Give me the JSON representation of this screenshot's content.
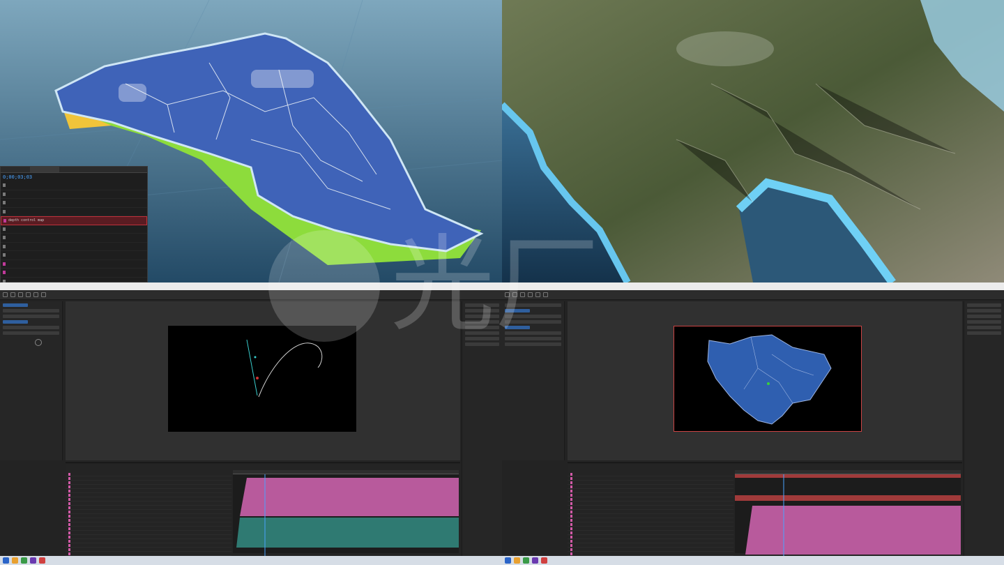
{
  "layer_panel": {
    "tabs": [
      "",
      "",
      "",
      "",
      ""
    ],
    "timecode": "0;00;03;03",
    "layers": [
      {
        "name": "",
        "color": "#7a7a7a"
      },
      {
        "name": "",
        "color": "#7a7a7a"
      },
      {
        "name": "",
        "color": "#7a7a7a"
      },
      {
        "name": "",
        "color": "#7a7a7a"
      },
      {
        "name": "depth control map",
        "color": "#c03a9a",
        "selected": true
      },
      {
        "name": "",
        "color": "#7a7a7a"
      },
      {
        "name": "",
        "color": "#7a7a7a"
      },
      {
        "name": "",
        "color": "#7a7a7a"
      },
      {
        "name": "",
        "color": "#7a7a7a"
      },
      {
        "name": "",
        "color": "#c03a9a"
      },
      {
        "name": "",
        "color": "#c03a9a"
      },
      {
        "name": "",
        "color": "#7a7a7a"
      }
    ]
  },
  "watermark": {
    "text": "光厂"
  },
  "colors": {
    "region_blue": "#2f5fb0",
    "timeline_pink": "#c05aa0",
    "timeline_teal": "#2f7a72",
    "ae_blue": "#2d8cff"
  },
  "icons": [
    "selection-tool-icon",
    "hand-tool-icon",
    "zoom-tool-icon",
    "pen-tool-icon",
    "text-tool-icon",
    "brush-tool-icon"
  ]
}
